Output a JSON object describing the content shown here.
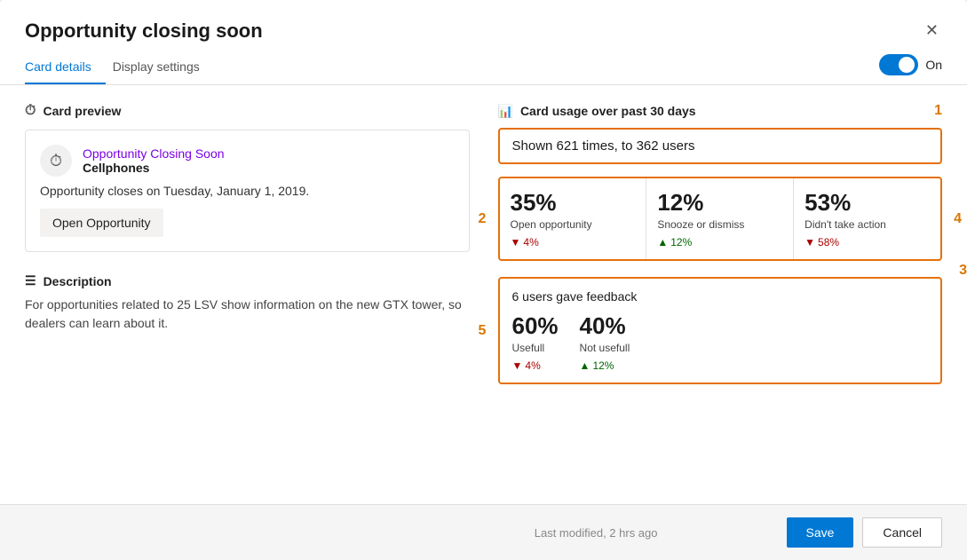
{
  "modal": {
    "title": "Opportunity closing soon",
    "close_label": "✕"
  },
  "tabs": {
    "card_details": "Card details",
    "display_settings": "Display settings",
    "toggle_label": "On"
  },
  "card_preview": {
    "section_title": "Card preview",
    "card_name": "Opportunity Closing Soon",
    "card_subtitle": "Cellphones",
    "card_body": "Opportunity closes on Tuesday, January 1, 2019.",
    "card_action": "Open Opportunity"
  },
  "description": {
    "title": "Description",
    "text": "For opportunities related to 25 LSV show information on the new GTX tower, so dealers can learn about it."
  },
  "usage": {
    "title": "Card usage over past 30 days",
    "num1": "1",
    "shown_text": "Shown 621 times, to 362 users",
    "num2": "2",
    "stats": [
      {
        "pct": "35%",
        "label": "Open opportunity",
        "change_dir": "down",
        "change_val": "4%"
      },
      {
        "pct": "12%",
        "label": "Snooze or dismiss",
        "change_dir": "up",
        "change_val": "12%"
      },
      {
        "pct": "53%",
        "label": "Didn't take action",
        "change_dir": "down",
        "change_val": "58%"
      }
    ],
    "num3": "3",
    "num4": "4",
    "feedback": {
      "title": "6 users gave feedback",
      "num5": "5",
      "items": [
        {
          "pct": "60%",
          "label": "Usefull",
          "change_dir": "down",
          "change_val": "4%"
        },
        {
          "pct": "40%",
          "label": "Not usefull",
          "change_dir": "up",
          "change_val": "12%"
        }
      ]
    }
  },
  "footer": {
    "modified": "Last modified, 2 hrs ago",
    "save": "Save",
    "cancel": "Cancel"
  }
}
